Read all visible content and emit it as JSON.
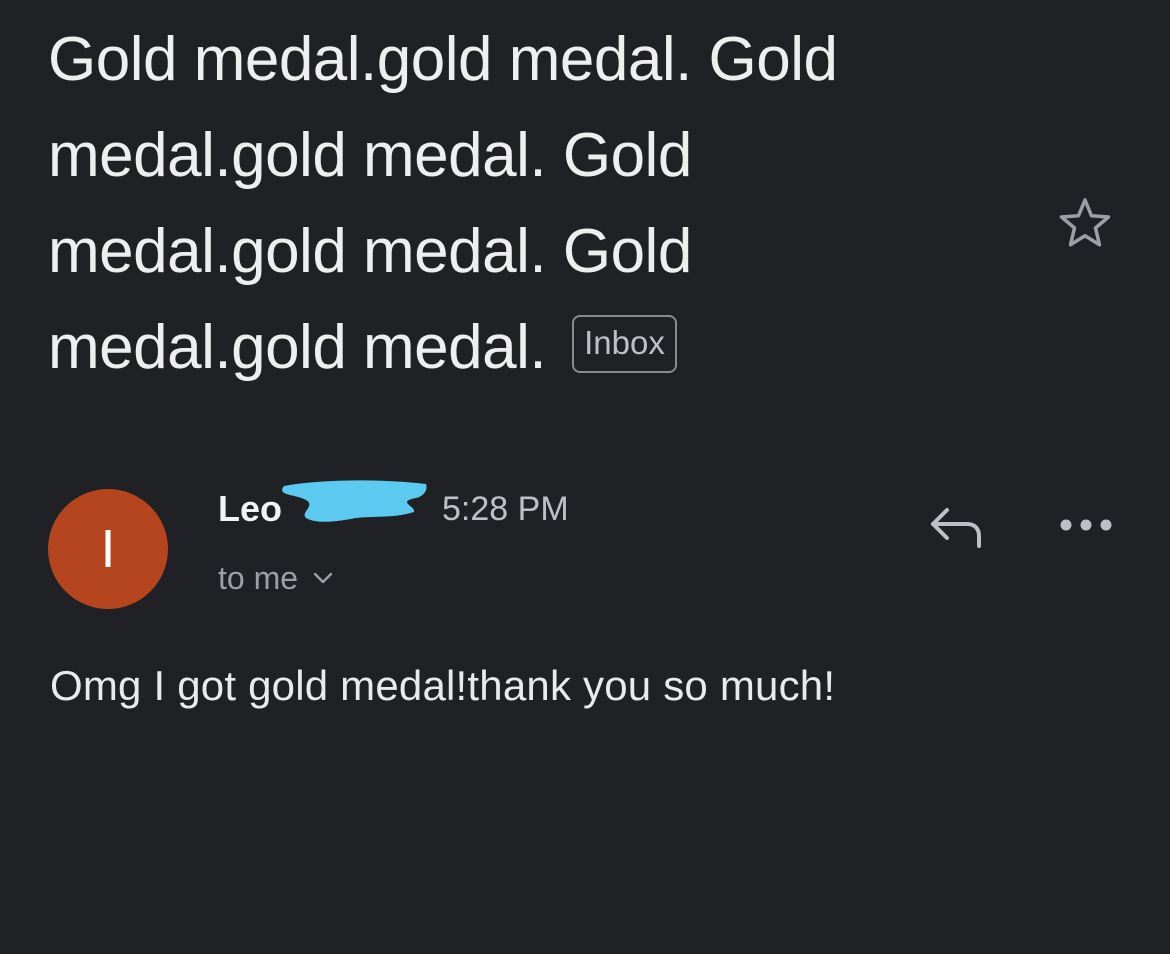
{
  "message": {
    "subject_lines": [
      "Gold medal.gold medal. Gold",
      "medal.gold medal. Gold",
      "medal.gold medal. Gold",
      "medal.gold medal."
    ],
    "label_badge": "Inbox",
    "sender": {
      "avatar_initial": "I",
      "avatar_color": "#b5451f",
      "name": "Leo",
      "name_redacted": true,
      "redaction_color": "#5ccaf0",
      "time": "5:28 PM"
    },
    "recipient_text": "to me",
    "body": "Omg I got gold medal!thank you so much!"
  },
  "icons": {
    "star": "star-outline-icon",
    "reply": "reply-icon",
    "more": "more-horizontal-icon",
    "expand": "chevron-down-icon"
  },
  "colors": {
    "background": "#202124",
    "text_primary": "#e8eaed",
    "text_secondary": "#9aa0a6",
    "icon": "#9aa0a6"
  }
}
